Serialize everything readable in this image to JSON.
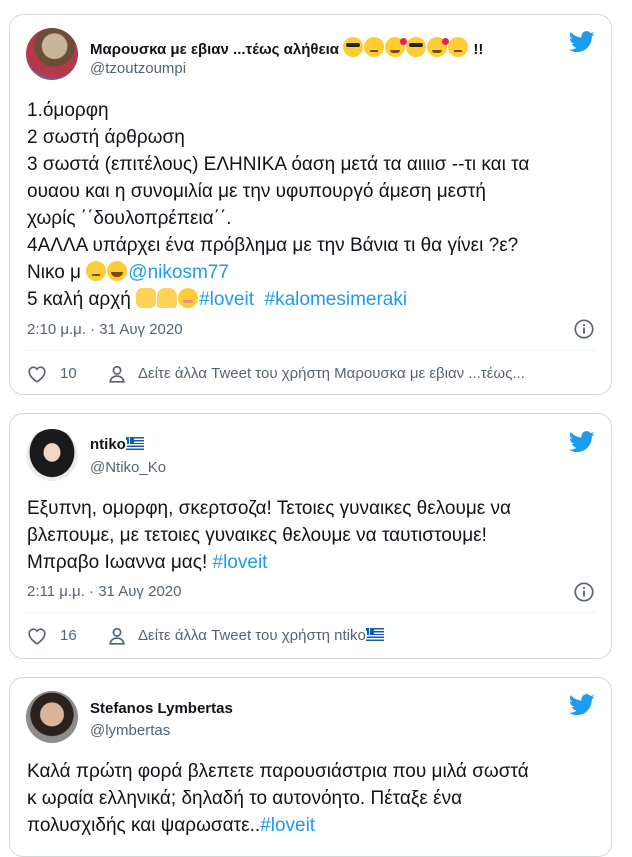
{
  "tweets": [
    {
      "display_name": "Μαρουσκα με εβιαν ...τέως αλήθεια",
      "name_suffix": "!!",
      "handle": "@tzoutzoumpi",
      "lines": [
        "1.όμορφη",
        "2 σωστή άρθρωση",
        "3 σωστά (επιτέλους) ΕΛΗΝΙΚΑ όαση μετά τα αιιιισ --τι και τα",
        "ουαου και η συνομιλία  με την υφυπουργό άμεση μεστή",
        "χωρίς ΄΄δουλοπρέπεια΄΄.",
        "4ΑΛΛΑ υπάρχει ένα πρόβλημα με την Βάνια τι θα γίνει ?ε?"
      ],
      "line7_text": "Νικο μ ",
      "line7_mention": "@nikosm77",
      "line8_text": "5 καλή αρχή  ",
      "line8_tag1": "#loveit",
      "line8_tag2": "#kalomesimeraki",
      "timestamp": "2:10 μ.μ. · 31 Αυγ 2020",
      "likes": "10",
      "more_text": "Δείτε άλλα Tweet του χρήστη Μαρουσκα με εβιαν ...τέως..."
    },
    {
      "display_name": "ntiko",
      "handle": "@Ntiko_Ko",
      "lines": [
        "Εξυπνη, ομορφη, σκερτσοζα! Τετοιες γυναικες θελουμε να",
        "βλεπουμε, με τετοιες γυναικες θελουμε να ταυτιστουμε!"
      ],
      "line3_text": "Μπραβο Ιωαννα μας!  ",
      "line3_tag": "#loveit",
      "timestamp": "2:11 μ.μ. · 31 Αυγ 2020",
      "likes": "16",
      "more_text": "Δείτε άλλα Tweet του χρήστη ntiko"
    },
    {
      "display_name": "Stefanos Lymbertas",
      "handle": "@lymbertas",
      "lines": [
        "Καλά πρώτη φορά βλεπετε παρουσιάστρια που μιλά σωστά",
        "κ ωραία ελληνικά; δηλαδή το αυτονόητο. Πέταξε ένα"
      ],
      "line3_text": "πολυσχιδής και ψαρωσατε..",
      "line3_tag": "#loveit"
    }
  ],
  "colors": {
    "link": "#1d9bf0",
    "muted": "#536471",
    "border": "#cfd9de",
    "twitter_blue": "#1d9bf0"
  }
}
